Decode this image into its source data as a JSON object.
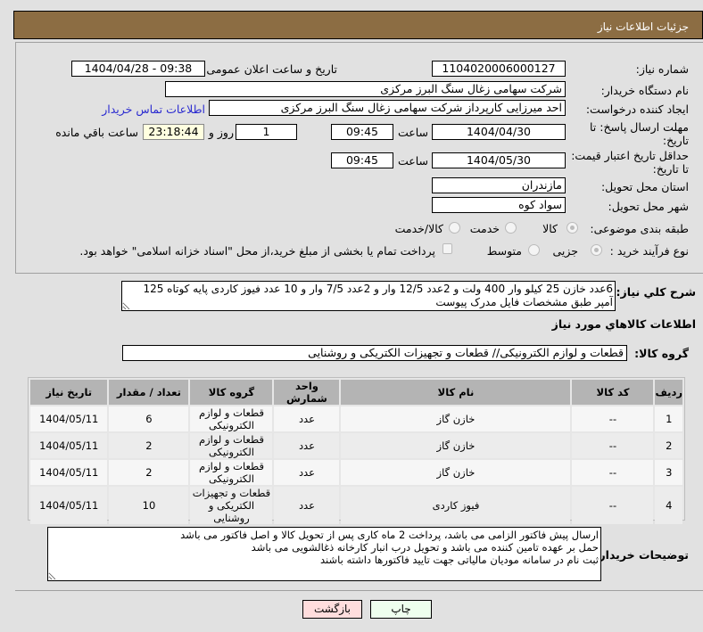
{
  "header": {
    "title": "جزئیات اطلاعات نیاز"
  },
  "form": {
    "need_number_label": "شماره نیاز:",
    "need_number": "1104020006000127",
    "announce_label": "تاریخ و ساعت اعلان عمومی:",
    "announce_value": "1404/04/28 - 09:38",
    "buyer_label": "نام دستگاه خریدار:",
    "buyer_value": "شرکت سهامی زغال سنگ البرز مرکزی",
    "creator_label": "ایجاد کننده درخواست:",
    "creator_value": "احد میرزایی کارپرداز شرکت سهامی زغال سنگ البرز مرکزی",
    "contact_link": "اطلاعات تماس خریدار",
    "deadline_label": "مهلت ارسال پاسخ: تا تاریخ:",
    "deadline_date": "1404/04/30",
    "time_label": "ساعت",
    "deadline_time": "09:45",
    "days_value": "1",
    "days_label": "روز و",
    "remaining_time": "23:18:44",
    "remaining_label": "ساعت باقي مانده",
    "validity_label": "حداقل تاریخ اعتبار قیمت: تا تاریخ:",
    "validity_date": "1404/05/30",
    "validity_time": "09:45",
    "province_label": "استان محل تحویل:",
    "province_value": "مازندران",
    "city_label": "شهر محل تحویل:",
    "city_value": "سواد کوه",
    "category_label": "طبقه بندی موضوعی:",
    "category_options": [
      "کالا",
      "خدمت",
      "کالا/خدمت"
    ],
    "category_selected": "کالا",
    "process_label": "نوع فرآیند خرید :",
    "process_options": [
      "جزیی",
      "متوسط"
    ],
    "process_selected": "جزیی",
    "payment_note": "پرداخت تمام یا بخشی از مبلغ خرید،از محل \"اسناد خزانه اسلامی\" خواهد بود."
  },
  "description": {
    "label": "شرح كلي نياز:",
    "value": "6عدد خازن 25 کیلو وار 400 ولت و 2عدد 12/5 وار و 2عدد 7/5 وار و 10 عدد فیوز کاردی پایه کوتاه 125 آمپر طبق مشخصات فایل مدرک پیوست"
  },
  "goods": {
    "heading": "اطلاعات كالاهاي مورد نياز",
    "group_label": "گروه کالا:",
    "group_value": "قطعات و لوازم الکترونیکی// قطعات و تجهیزات الکتریکی و روشنایی",
    "columns": [
      "ردیف",
      "کد کالا",
      "نام کالا",
      "واحد شمارش",
      "گروه کالا",
      "تعداد / مقدار",
      "تاریخ نیاز"
    ],
    "rows": [
      {
        "idx": "1",
        "code": "--",
        "name": "خازن گاز",
        "unit": "عدد",
        "group": "قطعات و لوازم الکترونیکی",
        "qty": "6",
        "date": "1404/05/11"
      },
      {
        "idx": "2",
        "code": "--",
        "name": "خازن گاز",
        "unit": "عدد",
        "group": "قطعات و لوازم الکترونیکی",
        "qty": "2",
        "date": "1404/05/11"
      },
      {
        "idx": "3",
        "code": "--",
        "name": "خازن گاز",
        "unit": "عدد",
        "group": "قطعات و لوازم الکترونیکی",
        "qty": "2",
        "date": "1404/05/11"
      },
      {
        "idx": "4",
        "code": "--",
        "name": "فیوز کاردی",
        "unit": "عدد",
        "group": "قطعات و تجهیزات الکتریکی و روشنایی",
        "qty": "10",
        "date": "1404/05/11"
      }
    ]
  },
  "notes": {
    "label": "توضیحات خریدار:",
    "value": "ارسال پیش فاکتور الزامی می باشد، پرداخت 2 ماه کاری پس از تحویل کالا و اصل فاکتور می باشد\nحمل بر عهده تامین کننده می باشد و تحویل درب انبار کارخانه ذغالشویی می باشد\nثبت نام در سامانه مودیان مالیاتی جهت تایید فاکتورها داشته باشند"
  },
  "buttons": {
    "print": "چاپ",
    "back": "بازگشت"
  },
  "colors": {
    "header": "#8c6d43",
    "countdown_bg": "#ffffe0",
    "print_bg": "#eeffee",
    "back_bg": "#ffdddd",
    "link": "#2a2ad0"
  }
}
